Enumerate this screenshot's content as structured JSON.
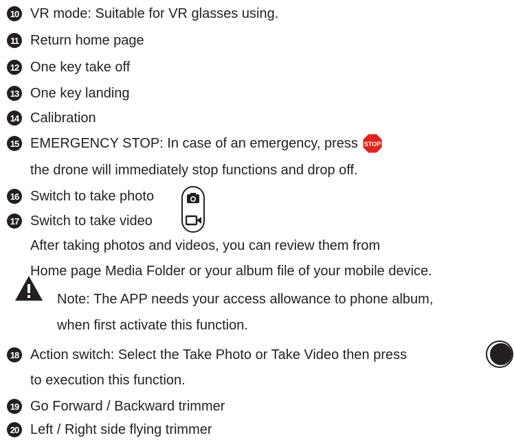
{
  "items": [
    {
      "num": "10",
      "text": "VR mode: Suitable for VR glasses using."
    },
    {
      "num": "11",
      "text": "Return home page"
    },
    {
      "num": "12",
      "text": "One key take off"
    },
    {
      "num": "13",
      "text": "One key landing"
    },
    {
      "num": "14",
      "text": "Calibration"
    },
    {
      "num": "15",
      "text": "EMERGENCY STOP: In case of an emergency,  press"
    },
    {
      "num": "16",
      "text": "Switch to take photo"
    },
    {
      "num": "17",
      "text": "Switch to take video"
    },
    {
      "num": "18",
      "text": "Action switch: Select the Take Photo or Take Video then press"
    },
    {
      "num": "19",
      "text": "Go Forward / Backward trimmer"
    },
    {
      "num": "20",
      "text": "Left / Right side flying trimmer"
    }
  ],
  "emergency_cont": "the drone will immediately stop functions and drop off.",
  "media_note_1": "After taking photos and videos, you can review them from",
  "media_note_2": "Home page Media Folder or your album file of your mobile device.",
  "note_1": "Note: The APP needs your access allowance to phone album,",
  "note_2": "when first activate this function.",
  "action_cont": "to execution this function.",
  "stop_label": "STOP",
  "icons": {
    "stop": "stop-sign-icon",
    "warning": "warning-icon",
    "photo": "camera-icon",
    "video": "video-camera-icon",
    "record": "record-button-icon"
  },
  "colors": {
    "text": "#231f20",
    "stop": "#e2231a"
  }
}
